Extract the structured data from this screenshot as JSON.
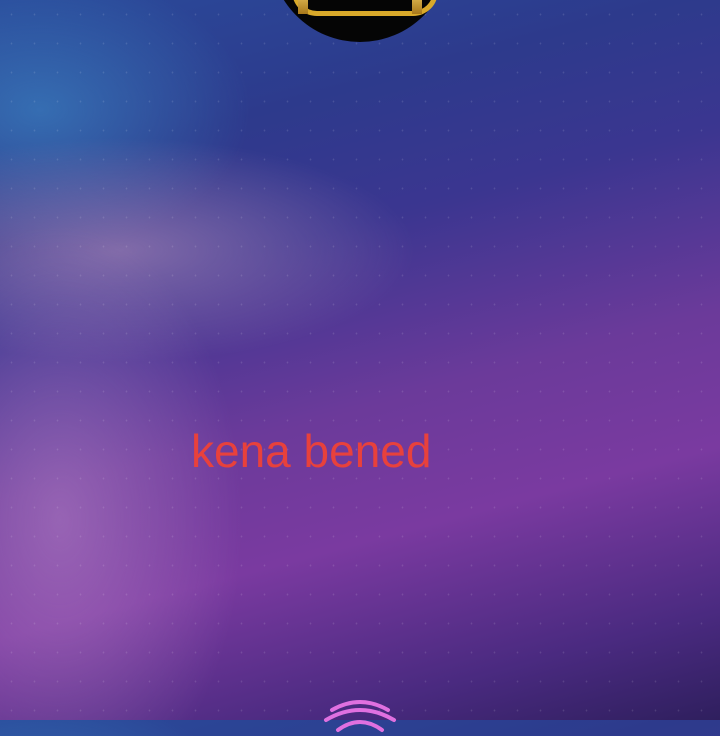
{
  "main": {
    "text": "kena bened"
  },
  "colors": {
    "text": "#e8413c",
    "fingerprint": "#e070e0"
  },
  "icons": [
    "logo-emblem",
    "fingerprint-icon"
  ]
}
